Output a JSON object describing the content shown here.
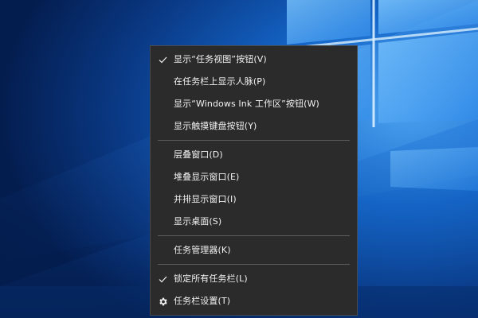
{
  "context_menu": {
    "groups": [
      {
        "items": [
          {
            "label": "显示“任务视图”按钮(V)",
            "checked": true
          },
          {
            "label": "在任务栏上显示人脉(P)",
            "checked": false
          },
          {
            "label": "显示“Windows Ink 工作区”按钮(W)",
            "checked": false
          },
          {
            "label": "显示触摸键盘按钮(Y)",
            "checked": false
          }
        ]
      },
      {
        "items": [
          {
            "label": "层叠窗口(D)"
          },
          {
            "label": "堆叠显示窗口(E)"
          },
          {
            "label": "并排显示窗口(I)"
          },
          {
            "label": "显示桌面(S)"
          }
        ]
      },
      {
        "items": [
          {
            "label": "任务管理器(K)"
          }
        ]
      },
      {
        "items": [
          {
            "label": "锁定所有任务栏(L)",
            "checked": true
          },
          {
            "label": "任务栏设置(T)",
            "icon": "gear-icon"
          }
        ]
      }
    ]
  },
  "colors": {
    "menu_bg": "#2b2b2b",
    "menu_text": "#f2f2f2",
    "separator": "#5b5b5b",
    "desktop_blue": "#0b3f86"
  },
  "icons": {
    "check": "checkmark-icon",
    "settings": "gear-icon"
  }
}
